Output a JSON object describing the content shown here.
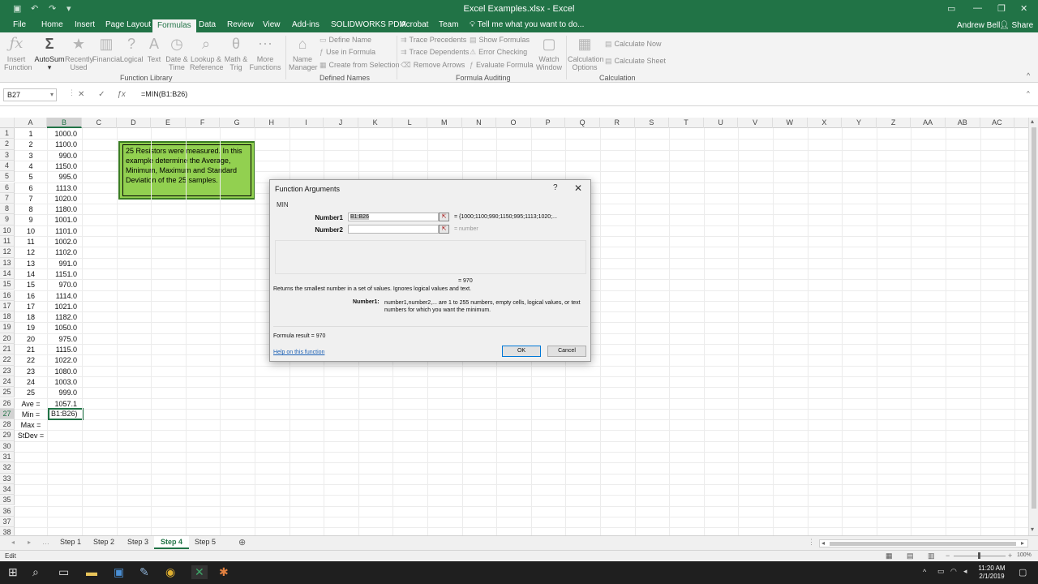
{
  "window": {
    "title": "Excel Examples.xlsx - Excel",
    "user": "Andrew Bell",
    "share": "Share"
  },
  "ribbon_tabs": [
    {
      "label": "File"
    },
    {
      "label": "Home"
    },
    {
      "label": "Insert"
    },
    {
      "label": "Page Layout"
    },
    {
      "label": "Formulas"
    },
    {
      "label": "Data"
    },
    {
      "label": "Review"
    },
    {
      "label": "View"
    },
    {
      "label": "Add-ins"
    },
    {
      "label": "SOLIDWORKS PDM"
    },
    {
      "label": "Acrobat"
    },
    {
      "label": "Team"
    }
  ],
  "tell_me": "Tell me what you want to do...",
  "ribbon": {
    "buttons": [
      {
        "label1": "Insert",
        "label2": "Function",
        "icon": "fx-icon"
      },
      {
        "label1": "AutoSum",
        "label2": "",
        "icon": "sigma-icon"
      },
      {
        "label1": "Recently",
        "label2": "Used",
        "icon": "star-book-icon"
      },
      {
        "label1": "Financial",
        "label2": "",
        "icon": "book-icon"
      },
      {
        "label1": "Logical",
        "label2": "",
        "icon": "question-book-icon"
      },
      {
        "label1": "Text",
        "label2": "",
        "icon": "a-book-icon"
      },
      {
        "label1": "Date &",
        "label2": "Time",
        "icon": "clock-book-icon"
      },
      {
        "label1": "Lookup &",
        "label2": "Reference",
        "icon": "magnifier-book-icon"
      },
      {
        "label1": "Math &",
        "label2": "Trig",
        "icon": "theta-book-icon"
      },
      {
        "label1": "More",
        "label2": "Functions",
        "icon": "dots-book-icon"
      },
      {
        "label1": "Name",
        "label2": "Manager",
        "icon": "tag-icon"
      },
      {
        "label1": "Watch",
        "label2": "Window",
        "icon": "glasses-icon"
      },
      {
        "label1": "Calculation",
        "label2": "Options",
        "icon": "calculator-icon"
      }
    ],
    "defined_names": [
      "Define Name",
      "Use in Formula",
      "Create from Selection"
    ],
    "auditing_left": [
      "Trace Precedents",
      "Trace Dependents",
      "Remove Arrows"
    ],
    "auditing_right": [
      "Show Formulas",
      "Error Checking",
      "Evaluate Formula"
    ],
    "calculation": [
      "Calculate Now",
      "Calculate Sheet"
    ],
    "groups": [
      "Function Library",
      "Defined Names",
      "Formula Auditing",
      "Calculation"
    ]
  },
  "formula_bar": {
    "name_box": "B27",
    "formula": "=MIN(B1:B26)"
  },
  "columns": [
    "A",
    "B",
    "C",
    "D",
    "E",
    "F",
    "G",
    "H",
    "I",
    "J",
    "K",
    "L",
    "M",
    "N",
    "O",
    "P",
    "Q",
    "R",
    "S",
    "T",
    "U",
    "V",
    "W",
    "X",
    "Y",
    "Z",
    "AA",
    "AB",
    "AC"
  ],
  "rows": [
    {
      "a": "1",
      "b": "1000.0"
    },
    {
      "a": "2",
      "b": "1100.0"
    },
    {
      "a": "3",
      "b": "990.0"
    },
    {
      "a": "4",
      "b": "1150.0"
    },
    {
      "a": "5",
      "b": "995.0"
    },
    {
      "a": "6",
      "b": "1113.0"
    },
    {
      "a": "7",
      "b": "1020.0"
    },
    {
      "a": "8",
      "b": "1180.0"
    },
    {
      "a": "9",
      "b": "1001.0"
    },
    {
      "a": "10",
      "b": "1101.0"
    },
    {
      "a": "11",
      "b": "1002.0"
    },
    {
      "a": "12",
      "b": "1102.0"
    },
    {
      "a": "13",
      "b": "991.0"
    },
    {
      "a": "14",
      "b": "1151.0"
    },
    {
      "a": "15",
      "b": "970.0"
    },
    {
      "a": "16",
      "b": "1114.0"
    },
    {
      "a": "17",
      "b": "1021.0"
    },
    {
      "a": "18",
      "b": "1182.0"
    },
    {
      "a": "19",
      "b": "1050.0"
    },
    {
      "a": "20",
      "b": "975.0"
    },
    {
      "a": "21",
      "b": "1115.0"
    },
    {
      "a": "22",
      "b": "1022.0"
    },
    {
      "a": "23",
      "b": "1080.0"
    },
    {
      "a": "24",
      "b": "1003.0"
    },
    {
      "a": "25",
      "b": "999.0"
    },
    {
      "a": "Ave =",
      "b": "1057.1"
    },
    {
      "a": "Min =",
      "b": "B1:B26)"
    },
    {
      "a": "Max =",
      "b": ""
    },
    {
      "a": "StDev =",
      "b": ""
    }
  ],
  "note": "25 Resistors were measured.  In this example determine the Average, Minimum, Maximum and Standard Deviation of the 25 samples.",
  "dialog": {
    "title": "Function Arguments",
    "help": "?",
    "function_name": "MIN",
    "arg1_label": "Number1",
    "arg1_value": "B1:B26",
    "arg1_result": "=  {1000;1100;990;1150;995;1113;1020;...",
    "arg2_label": "Number2",
    "arg2_value": "",
    "arg2_result": "=  number",
    "total": "=  970",
    "description": "Returns the smallest number in a set of values. Ignores logical values and text.",
    "arg_help_label": "Number1:",
    "arg_help": "number1,number2,... are 1 to 255 numbers, empty cells, logical values, or text numbers for which you want the minimum.",
    "formula_result": "Formula result =   970",
    "help_link": "Help on this function",
    "ok": "OK",
    "cancel": "Cancel"
  },
  "sheets": [
    {
      "label": "Step 1"
    },
    {
      "label": "Step 2"
    },
    {
      "label": "Step 3"
    },
    {
      "label": "Step 4"
    },
    {
      "label": "Step 5"
    }
  ],
  "active_sheet": "Step 4",
  "status": {
    "mode": "Edit",
    "zoom": "100%"
  },
  "taskbar": {
    "time": "11:20 AM",
    "date": "2/1/2019"
  }
}
